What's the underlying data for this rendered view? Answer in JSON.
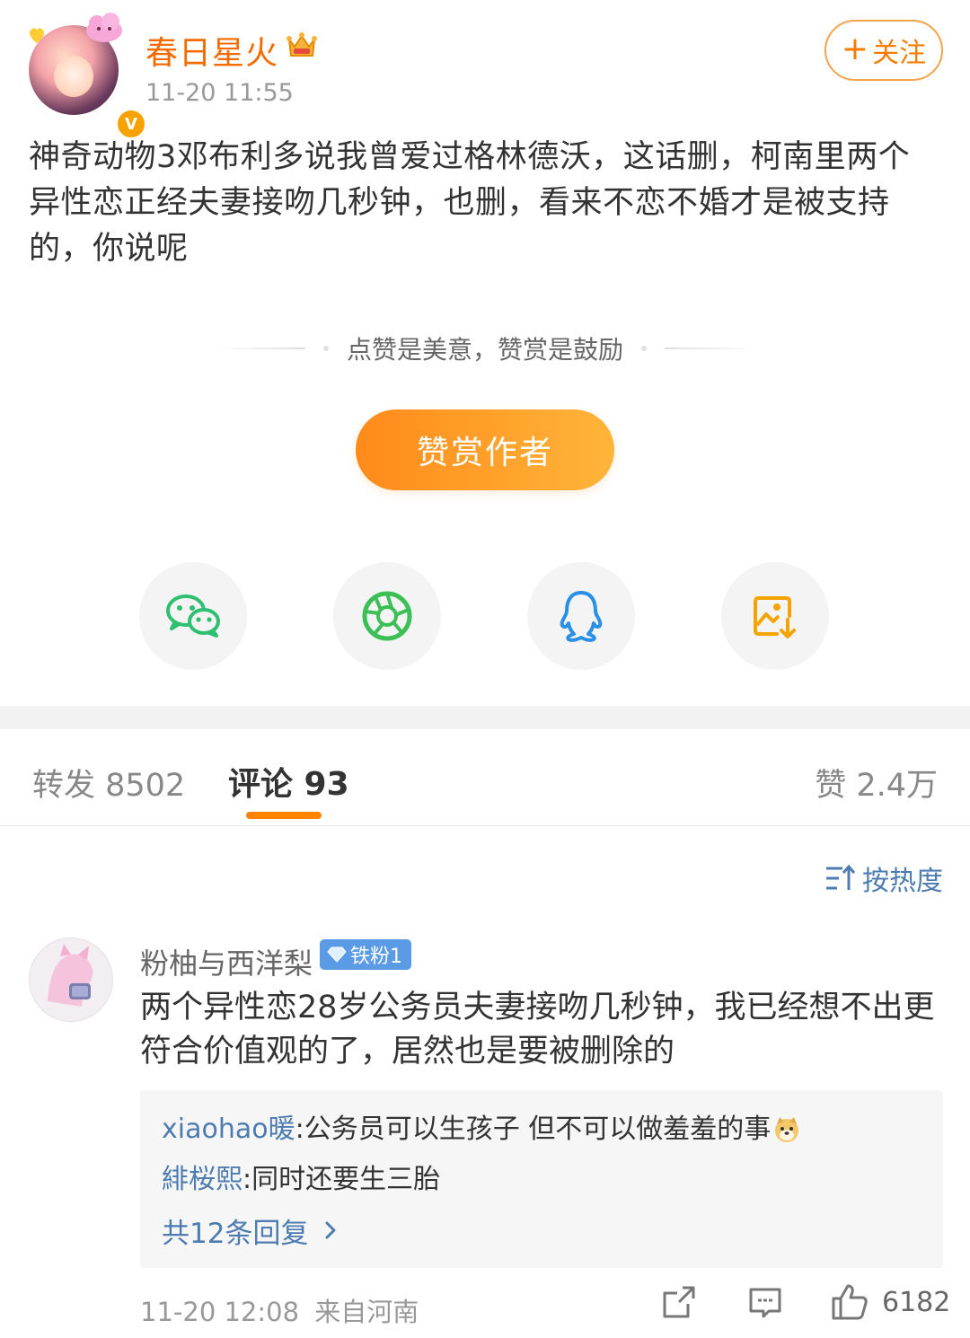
{
  "post": {
    "username": "春日星火",
    "time": "11-20 11:55",
    "follow_label": "关注",
    "body": "神奇动物3邓布利多说我曾爱过格林德沃，这话删，柯南里两个异性恋正经夫妻接吻几秒钟，也删，看来不恋不婚才是被支持的，你说呢"
  },
  "reward": {
    "tagline": "点赞是美意，赞赏是鼓励",
    "button_label": "赞赏作者"
  },
  "share": {
    "items": [
      {
        "name": "wechat-icon",
        "color": "#2fbf71"
      },
      {
        "name": "moments-icon",
        "color": "#3cbf55"
      },
      {
        "name": "qq-icon",
        "color": "#2a8fe6"
      },
      {
        "name": "save-image-icon",
        "color": "#f5a300"
      }
    ]
  },
  "tabs": {
    "repost": "转发 8502",
    "comment": "评论 93",
    "like": "赞 2.4万"
  },
  "sort": {
    "label": "按热度"
  },
  "comment": {
    "username": "粉柚与西洋梨",
    "badge": "铁粉1",
    "text": "两个异性恋28岁公务员夫妻接吻几秒钟，我已经想不出更符合价值观的了，居然也是要被删除的",
    "replies": [
      {
        "user": "xiaohao暖",
        "text": "公务员可以生孩子 但不可以做羞羞的事"
      },
      {
        "user": "緋桜熙",
        "text": "同时还要生三胎"
      }
    ],
    "more_replies": "共12条回复",
    "time": "11-20 12:08",
    "location": "来自河南",
    "likes": "6182"
  },
  "colors": {
    "accent": "#ff8200",
    "username": "#f56b00",
    "link": "#4d7cb0"
  }
}
